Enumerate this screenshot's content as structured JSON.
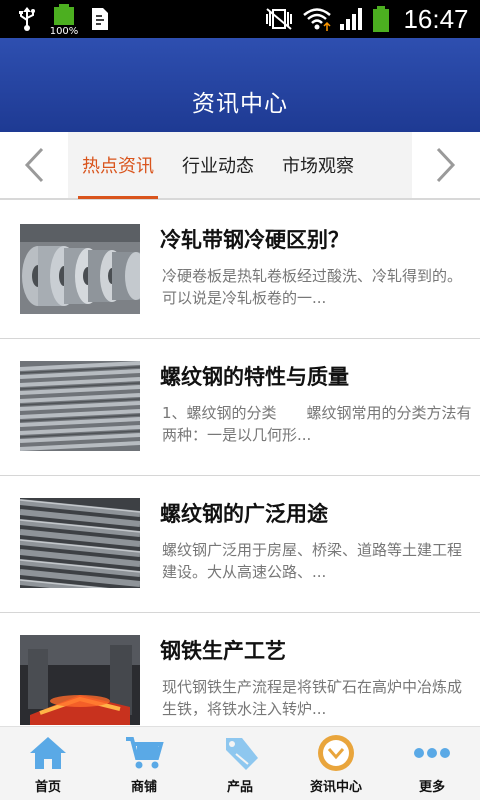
{
  "status_bar": {
    "battery_percent": "100%",
    "time": "16:47"
  },
  "header": {
    "title": "资讯中心"
  },
  "tabs": [
    {
      "label": "热点资讯",
      "active": true
    },
    {
      "label": "行业动态",
      "active": false
    },
    {
      "label": "市场观察",
      "active": false
    }
  ],
  "news": [
    {
      "title": "冷轧带钢冷硬区别？",
      "summary": "冷硬卷板是热轧卷板经过酸洗、冷轧得到的。可以说是冷轧板卷的一...",
      "image": "steel-coils-photo"
    },
    {
      "title": "螺纹钢的特性与质量",
      "summary": "1、螺纹钢的分类　　螺纹钢常用的分类方法有两种：一是以几何形...",
      "image": "rebar-bundle-photo"
    },
    {
      "title": "螺纹钢的广泛用途",
      "summary": "螺纹钢广泛用于房屋、桥梁、道路等土建工程建设。大从高速公路、...",
      "image": "rebar-closeup-photo"
    },
    {
      "title": "钢铁生产工艺",
      "summary": "现代钢铁生产流程是将铁矿石在高炉中冶炼成生铁，将铁水注入转炉...",
      "image": "steel-mill-photo"
    }
  ],
  "bottom_nav": [
    {
      "label": "首页",
      "icon": "home-icon"
    },
    {
      "label": "商铺",
      "icon": "cart-icon"
    },
    {
      "label": "产品",
      "icon": "sale-tag-icon"
    },
    {
      "label": "资讯中心",
      "icon": "news-badge-icon"
    },
    {
      "label": "更多",
      "icon": "more-dots-icon"
    }
  ],
  "colors": {
    "header_blue": "#1e3a93",
    "active_tab": "#d9541c",
    "icon_blue": "#5aa9e6",
    "text_gray": "#777777"
  }
}
